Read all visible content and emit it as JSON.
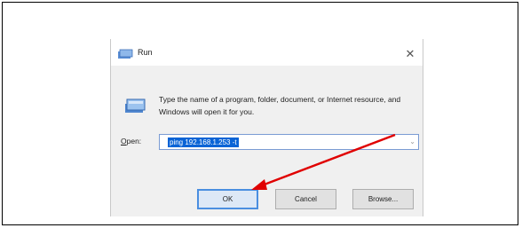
{
  "dialog": {
    "title": "Run",
    "description": "Type the name of a program, folder, document, or Internet resource, and Windows will open it for you.",
    "open_label_prefix": "O",
    "open_label_rest": "pen:",
    "open_value": "ping 192.168.1.253 -t",
    "ok_label": "OK",
    "cancel_label": "Cancel",
    "browse_label": "Browse..."
  },
  "colors": {
    "selection": "#0a64d6",
    "annotation_arrow": "#e00000",
    "default_button_border": "#4a8ee0"
  },
  "icons": {
    "title": "run-icon",
    "dialog": "run-icon",
    "close": "close-icon",
    "dropdown": "chevron-down-icon",
    "annotation": "arrow-annotation"
  }
}
